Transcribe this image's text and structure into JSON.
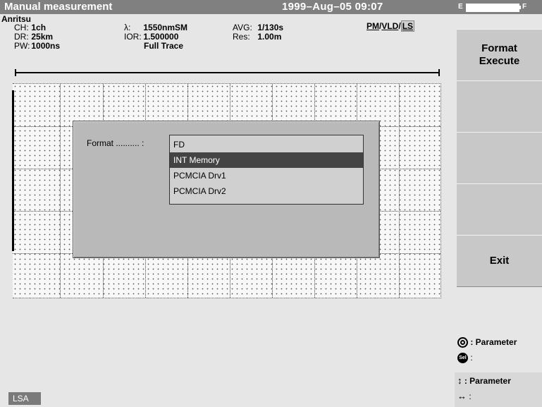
{
  "title": "Manual measurement",
  "datetime": "1999–Aug–05 09:07",
  "battery": {
    "empty_label": "E",
    "full_label": "F"
  },
  "brand": "Anritsu",
  "params": {
    "ch_label": "CH:",
    "ch_value": "1ch",
    "dr_label": "DR:",
    "dr_value": "25km",
    "pw_label": "PW:",
    "pw_value": "1000ns",
    "lambda_label": "λ:",
    "lambda_value": "1550nmSM",
    "ior_label": "IOR:",
    "ior_value": "1.500000",
    "trace_value": "Full Trace",
    "avg_label": "AVG:",
    "avg_value": "1/130s",
    "res_label": "Res:",
    "res_value": "1.00m"
  },
  "mode": {
    "pm": "PM",
    "vld": "VLD",
    "ls": "LS",
    "sep": "/"
  },
  "dialog": {
    "label": "Format .......... :",
    "options": [
      "FD",
      "INT Memory",
      "PCMCIA Drv1",
      "PCMCIA Drv2"
    ],
    "selected_index": 1
  },
  "softkeys": {
    "k1_line1": "Format",
    "k1_line2": "Execute",
    "k2": "",
    "k3": "",
    "k4": "",
    "k5": "Exit"
  },
  "help": {
    "encoder_text": ": Parameter",
    "sel_icon": "Sel",
    "sel_text": ":",
    "updown_text": ": Parameter",
    "leftright_text": ":"
  },
  "status": {
    "mode": "LSA"
  }
}
